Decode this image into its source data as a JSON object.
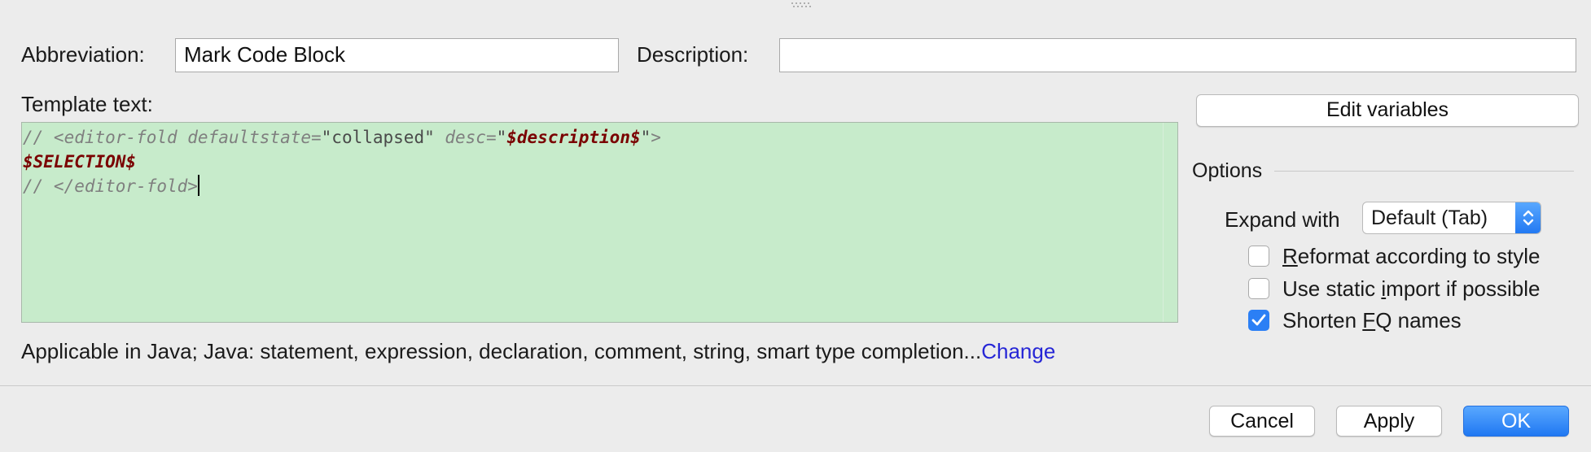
{
  "form": {
    "abbreviation_label": "Abbreviation:",
    "abbreviation_value": "Mark Code Block",
    "description_label": "Description:",
    "description_value": "",
    "template_label": "Template text:"
  },
  "template_lines": [
    [
      {
        "text": "// <editor-fold defaultstate=",
        "style": "cmt"
      },
      {
        "text": "\"collapsed\"",
        "style": "str"
      },
      {
        "text": " desc=",
        "style": "cmt"
      },
      {
        "text": "\"",
        "style": "str"
      },
      {
        "text": "$description$",
        "style": "var"
      },
      {
        "text": "\"",
        "style": "str"
      },
      {
        "text": ">",
        "style": "cmt"
      }
    ],
    [
      {
        "text": "$SELECTION$",
        "style": "var"
      }
    ],
    [
      {
        "text": "// </editor-fold>",
        "style": "cmt"
      }
    ]
  ],
  "edit_variables_label": "Edit variables",
  "options": {
    "title": "Options",
    "expand_label": "Expand with",
    "expand_value": "Default (Tab)",
    "checkboxes": [
      {
        "pre": "",
        "mnemonic": "R",
        "post": "eformat according to style",
        "checked": false
      },
      {
        "pre": "Use static ",
        "mnemonic": "i",
        "post": "mport if possible",
        "checked": false
      },
      {
        "pre": "Shorten ",
        "mnemonic": "F",
        "post": "Q names",
        "checked": true
      }
    ]
  },
  "applicable": {
    "text": "Applicable in Java; Java: statement, expression, declaration, comment, string, smart type completion...",
    "link": "Change"
  },
  "buttons": {
    "cancel": "Cancel",
    "apply": "Apply",
    "ok": "OK"
  },
  "colors": {
    "editor_bg": "#c7ebcb",
    "primary": "#2b7ff5",
    "link": "#2626d6",
    "variable": "#7a0000"
  }
}
